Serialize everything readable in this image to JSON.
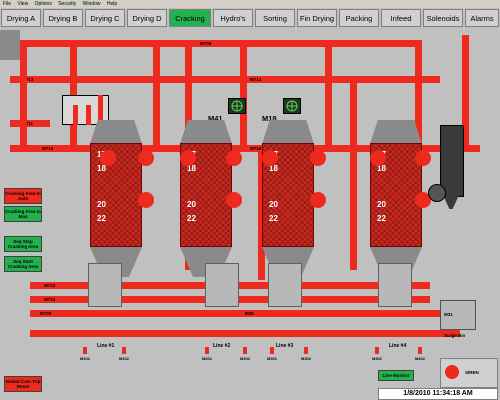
{
  "menu": [
    "File",
    "View",
    "Options",
    "Security",
    "Window",
    "Help"
  ],
  "tabs": [
    "Drying A",
    "Drying B",
    "Drying C",
    "Drying D",
    "Cracking",
    "Hydro's",
    "Sorting",
    "Fin Drying",
    "Packing",
    "Infeed",
    "Solenoids",
    "Alarms"
  ],
  "active_tab": "Cracking",
  "buttons": {
    "cracking_auto": "Cracking Area to Auto",
    "cracking_man": "Cracking Area to Man",
    "seq_stop": "Seq Stop Cracking Area",
    "seq_start": "Seq Start Cracking Area",
    "global_reset": "Global Com Trip Reset",
    "line_monitor": "Line Monitor",
    "siren": "SIREN"
  },
  "pipe_labels": {
    "m706": "M706",
    "m713": "M713",
    "m714": "M714",
    "m711": "M711",
    "m715": "M715",
    "m716": "M716",
    "m723": "M723",
    "m724": "M724",
    "m725": "M725",
    "m720": "M720",
    "m718": "M718",
    "m721": "M721",
    "m722": "M722",
    "m719": "M719",
    "m36": "M36",
    "m31": "M31"
  },
  "fans": [
    "M41",
    "M18"
  ],
  "dryer_numbers": [
    "17",
    "18",
    "20",
    "22"
  ],
  "lines": [
    "Line #1",
    "Line #2",
    "Line #3",
    "Line #4"
  ],
  "motors": [
    "M101",
    "M102",
    "M201",
    "M202",
    "M301",
    "M302",
    "M401",
    "M402"
  ],
  "surge_bin": "Surge Bin",
  "timestamp": "1/8/2010 11:34:18 AM",
  "colors": {
    "active": "#22b14c",
    "pipe": "#ee2a1e",
    "background": "#c4c4c4"
  }
}
